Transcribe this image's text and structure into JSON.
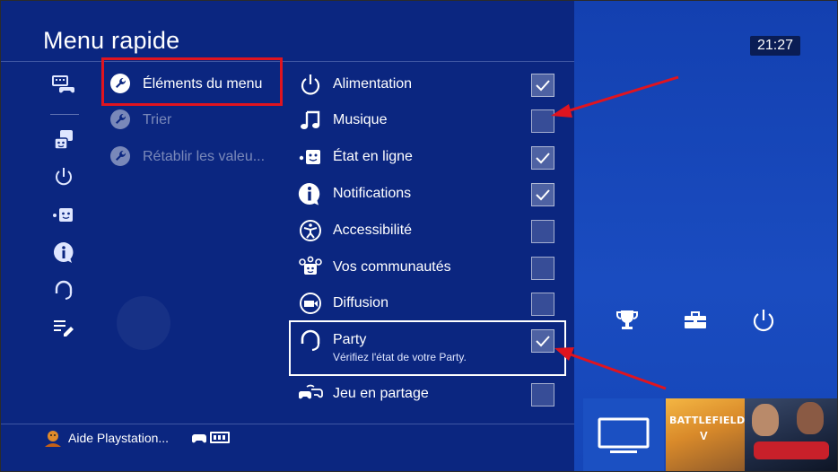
{
  "title": "Menu rapide",
  "clock": "21:27",
  "sidebar": {
    "icons": [
      "keyboard-controller-icon",
      "faces-icon",
      "power-icon",
      "status-face-icon",
      "info-icon",
      "headset-icon",
      "edit-list-icon"
    ]
  },
  "submenu": {
    "items": [
      {
        "label": "Éléments du menu",
        "icon": "wrench-icon",
        "active": true
      },
      {
        "label": "Trier",
        "icon": "wrench-icon",
        "active": false
      },
      {
        "label": "Rétablir les valeu...",
        "icon": "wrench-icon",
        "active": false
      }
    ]
  },
  "menu_items": [
    {
      "label": "Alimentation",
      "icon": "power-icon",
      "checked": true
    },
    {
      "label": "Musique",
      "icon": "music-note-icon",
      "checked": false
    },
    {
      "label": "État en ligne",
      "icon": "status-face-icon",
      "checked": true
    },
    {
      "label": "Notifications",
      "icon": "info-icon",
      "checked": true
    },
    {
      "label": "Accessibilité",
      "icon": "accessibility-icon",
      "checked": false
    },
    {
      "label": "Vos communautés",
      "icon": "communities-icon",
      "checked": false
    },
    {
      "label": "Diffusion",
      "icon": "broadcast-icon",
      "checked": false
    },
    {
      "label": "Party",
      "icon": "headset-icon",
      "checked": true,
      "description": "Vérifiez l'état de votre Party."
    },
    {
      "label": "Jeu en partage",
      "icon": "share-play-icon",
      "checked": false
    }
  ],
  "footer": {
    "user": "Aide Playstation..."
  },
  "home": {
    "tiles": [
      {
        "name": "tv-tile"
      },
      {
        "title": "BATTLEFIELD",
        "subtitle": "V"
      },
      {
        "name": "f1-2019-tile"
      }
    ]
  },
  "colors": {
    "panel_bg": "#0b2680",
    "home_bg": "#1340b0",
    "highlight_red": "#e0141f"
  }
}
